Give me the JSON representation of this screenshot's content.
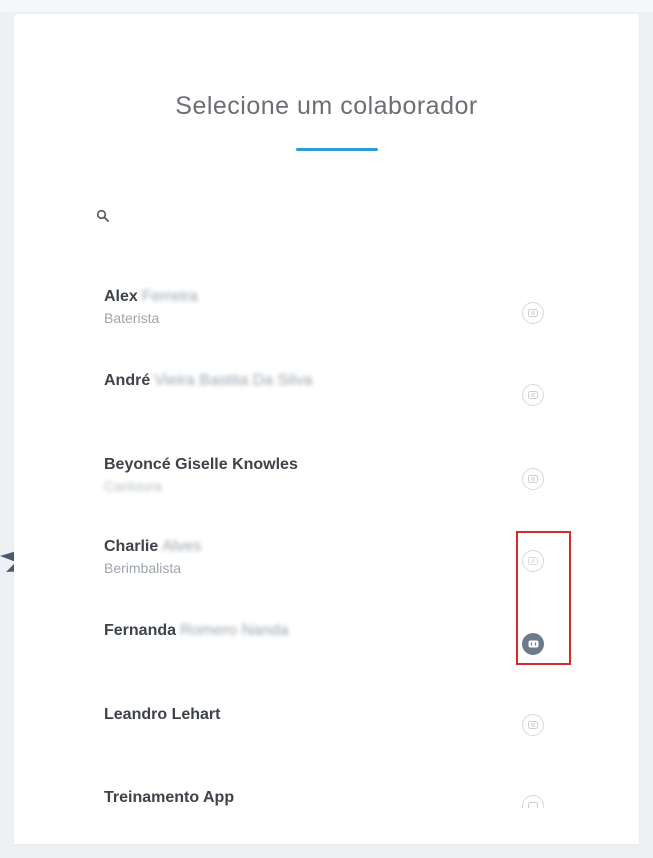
{
  "header": {
    "title": "Selecione um colaborador"
  },
  "search": {
    "placeholder": "",
    "value": "",
    "icon": "search-icon"
  },
  "colors": {
    "accent": "#2c9bd6",
    "highlight": "#d62b2b",
    "active_button": "#6d7a8a",
    "arrow": "#4a5a6e"
  },
  "collaborators": [
    {
      "first_name": "Alex",
      "last_name": "Ferreira",
      "role": "Baterista",
      "role_blurred": false,
      "active": false
    },
    {
      "first_name": "André",
      "last_name": "Vieira Bastita Da Silva",
      "role": "",
      "role_blurred": false,
      "active": false
    },
    {
      "first_name": "Beyoncé Giselle Knowles",
      "last_name": "",
      "role": "Cantoura",
      "role_blurred": true,
      "active": false
    },
    {
      "first_name": "Charlie",
      "last_name": "Alves",
      "role": "Berimbalista",
      "role_blurred": false,
      "active": false
    },
    {
      "first_name": "Fernanda",
      "last_name": "Romero Nanda",
      "role": "",
      "role_blurred": false,
      "active": true
    },
    {
      "first_name": "Leandro Lehart",
      "last_name": "",
      "role": "",
      "role_blurred": false,
      "active": false
    },
    {
      "first_name": "Treinamento App",
      "last_name": "",
      "role": "",
      "role_blurred": false,
      "active": false
    }
  ]
}
